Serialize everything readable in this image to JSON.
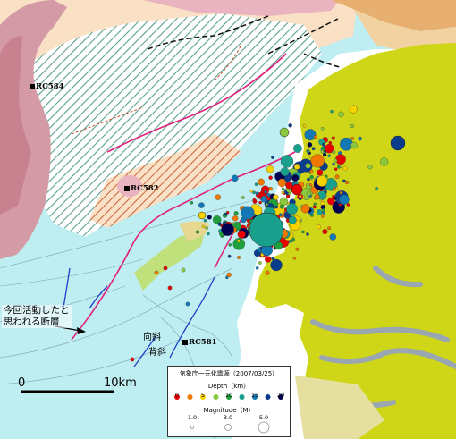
{
  "labels": {
    "stations": [
      "RC584",
      "RC582",
      "RC581"
    ],
    "fault_note_line1": "今回活動したと",
    "fault_note_line2": "思われる断層",
    "anticline": "背斜",
    "syncline": "向斜",
    "scale_zero": "0",
    "scale_ten": "10km"
  },
  "legend": {
    "title": "気象庁一元化震源（2007/03/25）",
    "depth_label": "Depth（km）",
    "depth_ticks": [
      "0",
      "5",
      "10",
      "15",
      "20"
    ],
    "depth_colors": [
      "#e60000",
      "#f07800",
      "#f5d200",
      "#8cc83c",
      "#1ea03c",
      "#19a08c",
      "#1478b4",
      "#0a3c8c",
      "#000050"
    ],
    "magnitude_label": "Magnitude（M）",
    "magnitude_ticks": [
      "1.0",
      "3.0",
      "5.0"
    ]
  },
  "map_colors": {
    "sea": "#bfeef2",
    "land": "#cfd617",
    "uplift": "#d49aa6",
    "shelf": "#fae0c4",
    "hatch": "#5aa08c",
    "fault_red": "#e0207c",
    "fault_blue": "#1f3fc8"
  },
  "quakes": [
    {
      "lon": 0,
      "lat": 0,
      "depth": 11,
      "mag": 6.9
    },
    {
      "lon": 0,
      "lat": 0,
      "depth": 18,
      "mag": 3.6
    },
    {
      "lon": 0,
      "lat": 0,
      "depth": 2,
      "mag": 3.5
    }
  ]
}
